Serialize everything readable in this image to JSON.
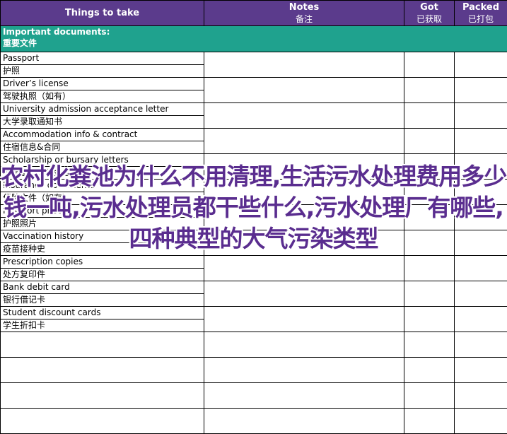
{
  "header": {
    "things_label": "Things to take",
    "notes_label": "Notes",
    "notes_sub": "备注",
    "got_label": "Got",
    "got_sub": "已获取",
    "packed_label": "Packed",
    "packed_sub": "已打包"
  },
  "section": {
    "title_en": "Important documents:",
    "title_zh": "重要文件"
  },
  "items": [
    {
      "en": "Passport",
      "zh": "护照"
    },
    {
      "en": "Driver’s license",
      "zh": "驾驶执照（如有）"
    },
    {
      "en": "University admission acceptance letter",
      "zh": "大学录取通知书"
    },
    {
      "en": "Accommodation info & contract",
      "zh": "住宿信息&合同"
    },
    {
      "en": "Scholarship or bursary letters",
      "zh": "奖学金或助学金证明"
    },
    {
      "en": "Insurance documents",
      "zh": "保险文件（如有）"
    },
    {
      "en": "Passport photos",
      "zh": "护照照片"
    },
    {
      "en": "Vaccination history",
      "zh": "疫苗接种史"
    },
    {
      "en": "Prescription copies",
      "zh": "处方复印件"
    },
    {
      "en": "Bank debit card",
      "zh": "银行借记卡"
    },
    {
      "en": "Student discount cards",
      "zh": "学生折扣卡"
    }
  ],
  "overlay_text": "农村化粪池为什么不用清理,生活污水处理费用多少钱一吨,污水处理员都干些什么,污水处理厂有哪些,四种典型的大气污染类型"
}
